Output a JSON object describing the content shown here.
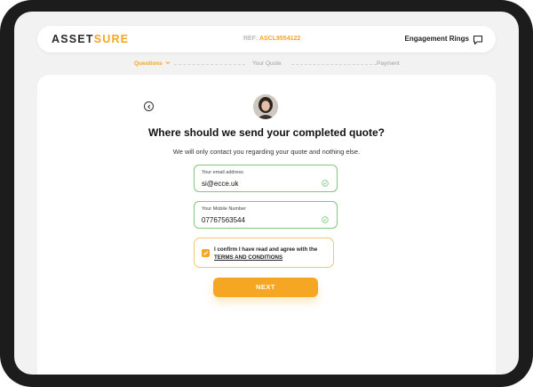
{
  "header": {
    "logo_part1": "ASSET",
    "logo_part2": "SURE",
    "ref_label": "REF:",
    "ref_code": "ASCL9554122",
    "product": "Engagement Rings",
    "chat_icon": "chat-bubble-icon"
  },
  "steps": [
    {
      "label": "Questions",
      "active": true,
      "icon": "chevron-down-icon"
    },
    {
      "label": "Your Quote",
      "active": false
    },
    {
      "label": "Payment",
      "active": false
    }
  ],
  "main": {
    "title": "Where should we send your completed quote?",
    "subtitle": "We will only contact you regarding your quote and nothing else.",
    "email_label": "Your email address",
    "email_value": "si@ecce.uk",
    "mobile_label": "Your Mobile Number",
    "mobile_value": "07767563544",
    "consent_text": "I confirm I have read and agree with the",
    "consent_link": "TERMS AND CONDITIONS",
    "consent_checked": true,
    "next_label": "NEXT"
  },
  "colors": {
    "accent": "#f5a623",
    "valid": "#7ec77e",
    "device": "#1c1c1c"
  }
}
